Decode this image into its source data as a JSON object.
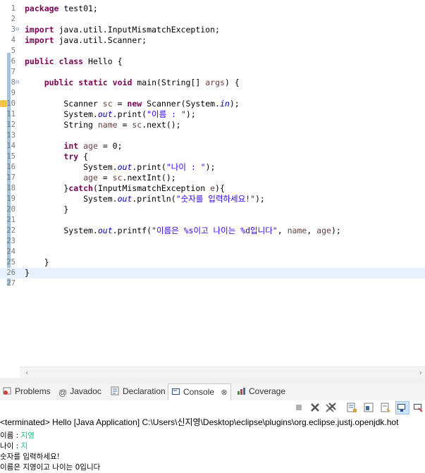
{
  "editor": {
    "lines": [
      {
        "n": "1",
        "html": "<span class=\"kw\">package</span> test01;"
      },
      {
        "n": "2",
        "html": ""
      },
      {
        "n": "3",
        "html": "<span class=\"kw\">import</span> java.util.InputMismatchException;"
      },
      {
        "n": "4",
        "html": "<span class=\"kw\">import</span> java.util.Scanner;"
      },
      {
        "n": "5",
        "html": ""
      },
      {
        "n": "6",
        "html": "<span class=\"kw\">public</span> <span class=\"kw\">class</span> Hello {"
      },
      {
        "n": "7",
        "html": ""
      },
      {
        "n": "8",
        "html": "    <span class=\"kw\">public</span> <span class=\"kw\">static</span> <span class=\"kw\">void</span> main(String[] <span class=\"var\">args</span>) {"
      },
      {
        "n": "9",
        "html": ""
      },
      {
        "n": "10",
        "html": "        Scanner <span class=\"var\">sc</span> = <span class=\"kw\">new</span> Scanner(System.<span class=\"fld\">in</span>);"
      },
      {
        "n": "11",
        "html": "        System.<span class=\"fld\">out</span>.print(<span class=\"str\">\"이름 : \"</span>);"
      },
      {
        "n": "12",
        "html": "        String <span class=\"var\">name</span> = <span class=\"var\">sc</span>.next();"
      },
      {
        "n": "13",
        "html": ""
      },
      {
        "n": "14",
        "html": "        <span class=\"kw\">int</span> <span class=\"var\">age</span> = 0;"
      },
      {
        "n": "15",
        "html": "        <span class=\"kw\">try</span> {"
      },
      {
        "n": "16",
        "html": "            System.<span class=\"fld\">out</span>.print(<span class=\"str\">\"나이 : \"</span>);"
      },
      {
        "n": "17",
        "html": "            <span class=\"var\">age</span> = <span class=\"var\">sc</span>.nextInt();"
      },
      {
        "n": "18",
        "html": "        }<span class=\"kw\">catch</span>(InputMismatchException <span class=\"var\">e</span>){"
      },
      {
        "n": "19",
        "html": "            System.<span class=\"fld\">out</span>.println(<span class=\"str\">\"숫자를 입력하세요!\"</span>);"
      },
      {
        "n": "20",
        "html": "        }"
      },
      {
        "n": "21",
        "html": ""
      },
      {
        "n": "22",
        "html": "        System.<span class=\"fld\">out</span>.printf(<span class=\"str\">\"이름은 %s이고 나이는 %d입니다\"</span>, <span class=\"var\">name</span>, <span class=\"var\">age</span>);"
      },
      {
        "n": "23",
        "html": ""
      },
      {
        "n": "24",
        "html": ""
      },
      {
        "n": "25",
        "html": "    }"
      },
      {
        "n": "26",
        "html": "}"
      },
      {
        "n": "27",
        "html": ""
      }
    ]
  },
  "tabs": {
    "problems": "Problems",
    "javadoc": "Javadoc",
    "declaration": "Declaration",
    "console": "Console",
    "coverage": "Coverage"
  },
  "console": {
    "terminated": "<terminated> Hello [Java Application] C:\\Users\\신지영\\Desktop\\eclipse\\plugins\\org.eclipse.justj.openjdk.hot",
    "lines": [
      {
        "prompt": "이름 : ",
        "input": "지영"
      },
      {
        "prompt": "나이 : ",
        "input": "지"
      },
      {
        "prompt": "숫자를 입력하세요!",
        "input": ""
      },
      {
        "prompt": "이름은 지영이고 나이는 0입니다",
        "input": ""
      }
    ]
  }
}
